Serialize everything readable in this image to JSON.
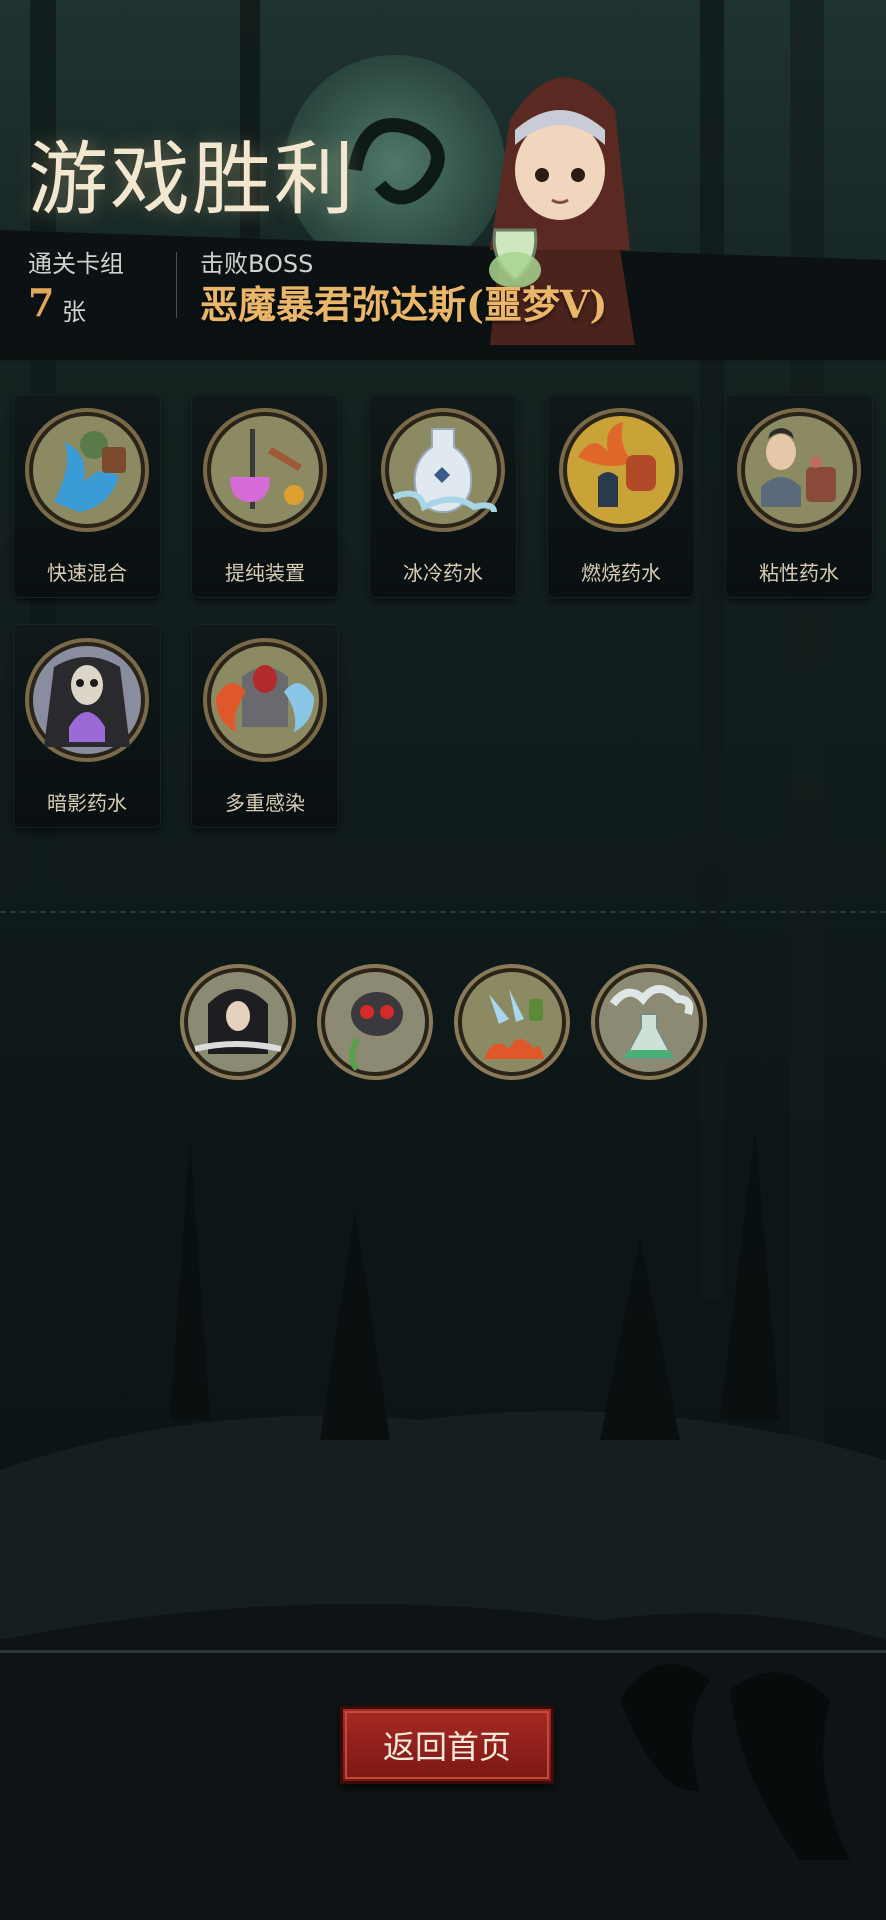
{
  "header": {
    "title": "游戏胜利",
    "deck_label": "通关卡组",
    "deck_count": "7",
    "deck_unit": "张",
    "boss_label": "击败BOSS",
    "boss_name": "恶魔暴君弥达斯(噩梦V)"
  },
  "cards": [
    {
      "name": "快速混合",
      "icon": "quick-mix-icon",
      "accent": "#3a9bd6"
    },
    {
      "name": "提纯装置",
      "icon": "purifier-icon",
      "accent": "#d46bd6"
    },
    {
      "name": "冰冷药水",
      "icon": "ice-potion-icon",
      "accent": "#a9d6e6"
    },
    {
      "name": "燃烧药水",
      "icon": "fire-potion-icon",
      "accent": "#e0672a"
    },
    {
      "name": "粘性药水",
      "icon": "sticky-potion-icon",
      "accent": "#8a6a4a"
    },
    {
      "name": "暗影药水",
      "icon": "shadow-potion-icon",
      "accent": "#9a6ad6"
    },
    {
      "name": "多重感染",
      "icon": "multi-infection-icon",
      "accent": "#e0572a"
    }
  ],
  "relics": [
    {
      "icon": "hooded-rogue-icon"
    },
    {
      "icon": "skull-mask-icon"
    },
    {
      "icon": "ice-fire-shards-icon"
    },
    {
      "icon": "flask-smoke-icon"
    }
  ],
  "footer": {
    "home_button": "返回首页"
  }
}
